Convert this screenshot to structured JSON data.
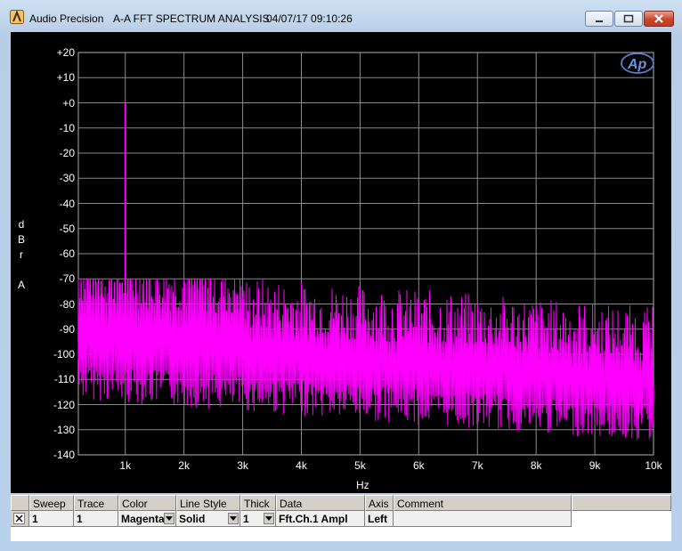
{
  "window": {
    "app_name": "Audio Precision",
    "doc_title": "A-A FFT SPECTRUM ANALYSIS",
    "timestamp": "04/07/17 09:10:26"
  },
  "controls": {
    "minimize_icon": "minimize-icon",
    "maximize_icon": "maximize-icon",
    "close_icon": "close-icon"
  },
  "logo_text": "Ap",
  "chart_data": {
    "type": "line",
    "xlabel": "Hz",
    "ylabel": [
      "d",
      "B",
      "r",
      "",
      "A"
    ],
    "ylim": [
      -140,
      20
    ],
    "xlim": [
      200,
      10000
    ],
    "grid": true,
    "y_ticks": [
      "+20",
      "+10",
      "+0",
      "-10",
      "-20",
      "-30",
      "-40",
      "-50",
      "-60",
      "-70",
      "-80",
      "-90",
      "-100",
      "-110",
      "-120",
      "-130",
      "-140"
    ],
    "x_ticks": [
      "1k",
      "2k",
      "3k",
      "4k",
      "5k",
      "6k",
      "7k",
      "8k",
      "9k",
      "10k"
    ],
    "series": [
      {
        "color": "#ff00ff",
        "x": [
          200,
          250,
          300,
          400,
          500,
          600,
          700,
          800,
          900,
          1000,
          1100,
          1200,
          1400,
          1600,
          1800,
          2000,
          2200,
          2500,
          2800,
          3000,
          3500,
          4000,
          4500,
          5000,
          5500,
          6000,
          6500,
          7000,
          7500,
          8000,
          8500,
          9000,
          9500,
          10000
        ],
        "values": [
          -95,
          -72,
          -100,
          -75,
          -98,
          -76,
          -100,
          -78,
          -95,
          0,
          -90,
          -83,
          -85,
          -86,
          -92,
          -70,
          -88,
          -92,
          -88,
          -90,
          -97,
          -100,
          -101,
          -103,
          -104,
          -105,
          -106,
          -107,
          -107,
          -108,
          -109,
          -110,
          -111,
          -113
        ]
      }
    ]
  },
  "table": {
    "headers": [
      "Sweep",
      "Trace",
      "Color",
      "Line Style",
      "Thick",
      "Data",
      "Axis",
      "Comment"
    ],
    "row": {
      "sweep": "1",
      "trace": "1",
      "color": "Magenta",
      "line_style": "Solid",
      "thick": "1",
      "data": "Fft.Ch.1 Ampl",
      "axis": "Left",
      "comment": ""
    }
  }
}
